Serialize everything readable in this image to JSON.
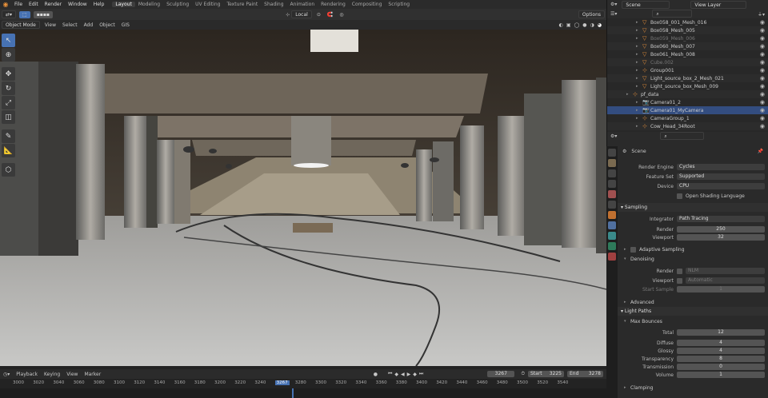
{
  "topbar": {
    "menus": [
      "File",
      "Edit",
      "Render",
      "Window",
      "Help"
    ],
    "workspaces": [
      "Layout",
      "Modeling",
      "Sculpting",
      "UV Editing",
      "Texture Paint",
      "Shading",
      "Animation",
      "Rendering",
      "Compositing",
      "Scripting"
    ],
    "active_workspace": "Layout"
  },
  "header": {
    "orientation": "Local",
    "options": "Options"
  },
  "viewport_header": {
    "mode": "Object Mode",
    "menus": [
      "View",
      "Select",
      "Add",
      "Object",
      "GIS"
    ]
  },
  "timeline": {
    "menus": [
      "Playback",
      "Keying",
      "View",
      "Marker"
    ],
    "current_frame": "3267",
    "start_label": "Start",
    "start": "3225",
    "end_label": "End",
    "end": "3278",
    "ticks": [
      "3000",
      "3020",
      "3040",
      "3060",
      "3080",
      "3100",
      "3120",
      "3140",
      "3160",
      "3180",
      "3200",
      "3220",
      "3240",
      "3267",
      "3280",
      "3300",
      "3320",
      "3340",
      "3360",
      "3380",
      "3400",
      "3420",
      "3440",
      "3460",
      "3480",
      "3500",
      "3520",
      "3540"
    ]
  },
  "outliner": {
    "scene": "Scene",
    "view_layer": "View Layer",
    "rows": [
      {
        "name": "Box058_001_Mesh_016",
        "indent": 3,
        "icon": "mesh"
      },
      {
        "name": "Box058_Mesh_005",
        "indent": 3,
        "icon": "mesh"
      },
      {
        "name": "Box059_Mesh_006",
        "indent": 3,
        "icon": "mesh",
        "dim": true
      },
      {
        "name": "Box060_Mesh_007",
        "indent": 3,
        "icon": "mesh"
      },
      {
        "name": "Box061_Mesh_008",
        "indent": 3,
        "icon": "mesh"
      },
      {
        "name": "Cube.002",
        "indent": 3,
        "icon": "mesh",
        "dim": true
      },
      {
        "name": "Group001",
        "indent": 3,
        "icon": "empty"
      },
      {
        "name": "Light_source_box_2_Mesh_021",
        "indent": 3,
        "icon": "mesh"
      },
      {
        "name": "Light_source_box_Mesh_009",
        "indent": 3,
        "icon": "mesh"
      },
      {
        "name": "pf_data",
        "indent": 2,
        "icon": "empty"
      },
      {
        "name": "Camera01_2",
        "indent": 3,
        "icon": "camera"
      },
      {
        "name": "Camera01_MyCamera",
        "indent": 3,
        "icon": "camera",
        "selected": true
      },
      {
        "name": "CameraGroup_1",
        "indent": 3,
        "icon": "empty"
      },
      {
        "name": "Cow_Head_34Root",
        "indent": 3,
        "icon": "empty"
      }
    ]
  },
  "properties": {
    "scene": "Scene",
    "render_engine": {
      "label": "Render Engine",
      "value": "Cycles"
    },
    "feature_set": {
      "label": "Feature Set",
      "value": "Supported"
    },
    "device": {
      "label": "Device",
      "value": "CPU"
    },
    "osl": "Open Shading Language",
    "sampling": {
      "title": "Sampling",
      "integrator_label": "Integrator",
      "integrator": "Path Tracing",
      "render_label": "Render",
      "render": "250",
      "viewport_label": "Viewport",
      "viewport": "32"
    },
    "adaptive": "Adaptive Sampling",
    "denoising": {
      "title": "Denoising",
      "render_label": "Render",
      "render": "NLM",
      "viewport_label": "Viewport",
      "viewport": "Automatic",
      "start_label": "Start Sample",
      "start": "1"
    },
    "advanced": "Advanced",
    "light_paths": {
      "title": "Light Paths",
      "max_bounces": "Max Bounces",
      "total_label": "Total",
      "total": "12",
      "diffuse_label": "Diffuse",
      "diffuse": "4",
      "glossy_label": "Glossy",
      "glossy": "4",
      "transparency_label": "Transparency",
      "transparency": "8",
      "transmission_label": "Transmission",
      "transmission": "0",
      "volume_label": "Volume",
      "volume": "1"
    },
    "clamping": "Clamping"
  }
}
